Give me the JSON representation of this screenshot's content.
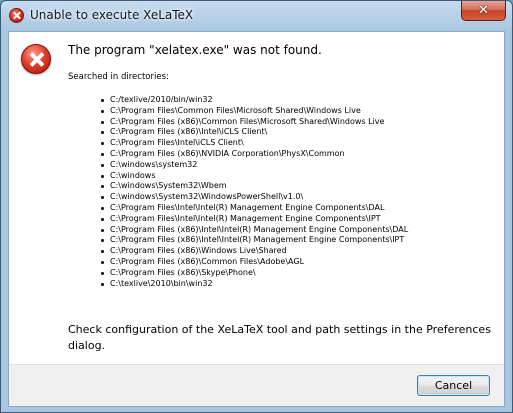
{
  "window": {
    "title": "Unable to execute XeLaTeX",
    "close_glyph": "✕",
    "accent": "#c5432a"
  },
  "dialog": {
    "icon": "error-icon",
    "main_instruction": "The program \"xelatex.exe\" was not found.",
    "searched_label": "Searched in directories:",
    "directories": [
      "C:/texlive/2010/bin/win32",
      "C:\\Program Files\\Common Files\\Microsoft Shared\\Windows Live",
      "C:\\Program Files (x86)\\Common Files\\Microsoft Shared\\Windows Live",
      "C:\\Program Files (x86)\\Intel\\iCLS Client\\",
      "C:\\Program Files\\Intel\\iCLS Client\\",
      "C:\\Program Files (x86)\\NVIDIA Corporation\\PhysX\\Common",
      "C:\\windows\\system32",
      "C:\\windows",
      "C:\\windows\\System32\\Wbem",
      "C:\\windows\\System32\\WindowsPowerShell\\v1.0\\",
      "C:\\Program Files\\Intel\\Intel(R) Management Engine Components\\DAL",
      "C:\\Program Files\\Intel\\Intel(R) Management Engine Components\\IPT",
      "C:\\Program Files (x86)\\Intel\\Intel(R) Management Engine Components\\DAL",
      "C:\\Program Files (x86)\\Intel\\Intel(R) Management Engine Components\\IPT",
      "C:\\Program Files (x86)\\Windows Live\\Shared",
      "C:\\Program Files (x86)\\Common Files\\Adobe\\AGL",
      "C:\\Program Files (x86)\\Skype\\Phone\\",
      "C:\\texlive\\2010\\bin\\win32"
    ],
    "footer_text": "Check configuration of the XeLaTeX tool and path settings in the Preferences dialog."
  },
  "buttons": {
    "cancel_label": "Cancel"
  }
}
